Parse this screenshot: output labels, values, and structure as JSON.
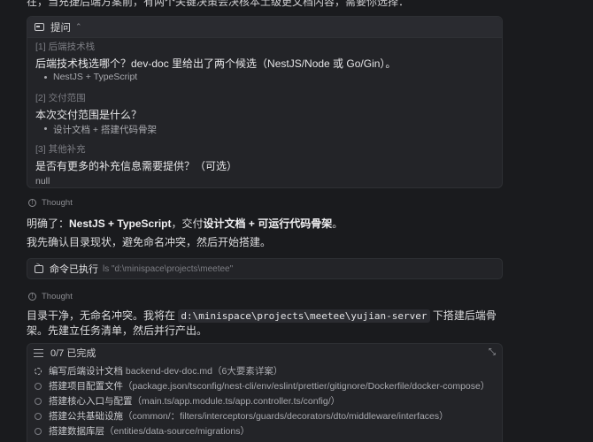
{
  "top_partial_text": "在，当充捷后端方案前，有两个关键决策会决核本土级更文档内容，需要你选择：",
  "ask_panel": {
    "title": "提问",
    "sections": [
      {
        "label": "[1] 后端技术栈",
        "question": "后端技术栈选哪个？dev-doc 里给出了两个候选（NestJS/Node 或 Go/Gin）。",
        "answer": "NestJS + TypeScript"
      },
      {
        "label": "[2] 交付范围",
        "question": "本次交付范围是什么？",
        "answer": "设计文档 + 搭建代码骨架"
      },
      {
        "label": "[3] 其他补充",
        "question": "是否有更多的补充信息需要提供？（可选）",
        "answer": "null"
      }
    ]
  },
  "thought1": "Thought",
  "msg1": {
    "prefix": "明确了：",
    "b1": "NestJS + TypeScript",
    "mid": "，交付",
    "b2": "设计文档 + 可运行代码骨架",
    "end": "。"
  },
  "msg2": "我先确认目录现状，避免命名冲突，然后开始搭建。",
  "command": {
    "label": "命令已执行",
    "path": "ls \"d:\\minispace\\projects\\meetee\""
  },
  "thought2": "Thought",
  "msg3": {
    "before": "目录干净，无命名冲突。我将在 ",
    "code": "d:\\minispace\\projects\\meetee\\yujian-server",
    "after": " 下搭建后端骨架。先建立任务清单，然后并行产出。"
  },
  "tasks": {
    "progress": "0/7 已完成",
    "items": [
      {
        "title": "编写后端设计文档",
        "desc": "backend-dev-doc.md（6大要素详案）"
      },
      {
        "title": "搭建项目配置文件",
        "desc": "（package.json/tsconfig/nest-cli/env/eslint/prettier/gitignore/Dockerfile/docker-compose）"
      },
      {
        "title": "搭建核心入口与配置",
        "desc": "（main.ts/app.module.ts/app.controller.ts/config/）"
      },
      {
        "title": "搭建公共基础设施",
        "desc": "（common/：filters/interceptors/guards/decorators/dto/middleware/interfaces）"
      },
      {
        "title": "搭建数据库层",
        "desc": "（entities/data-source/migrations）"
      }
    ]
  }
}
